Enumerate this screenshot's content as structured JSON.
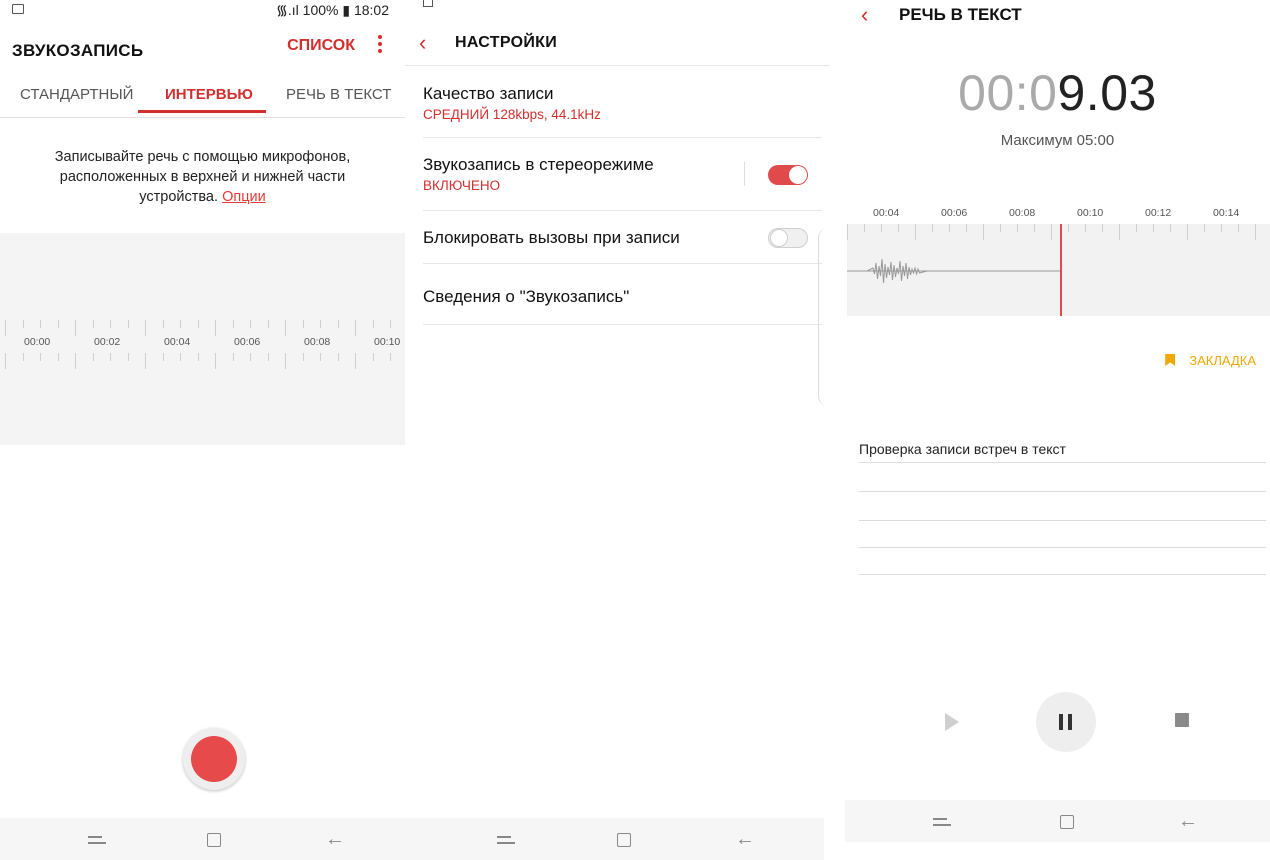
{
  "panel1": {
    "status": {
      "right": "᯾.ıl 100% ▮ 18:02"
    },
    "title": "ЗВУКОЗАПИСЬ",
    "list_label": "СПИСОК",
    "tabs": [
      "СТАНДАРТНЫЙ",
      "ИНТЕРВЬЮ",
      "РЕЧЬ В ТЕКСТ"
    ],
    "active_tab": "ИНТЕРВЬЮ",
    "description": "Записывайте речь с помощью микрофонов, расположенных в верхней и нижней части устройства.",
    "options_link": "Опции",
    "timeline": [
      "00:00",
      "00:02",
      "00:04",
      "00:06",
      "00:08",
      "00:10"
    ],
    "icons": {
      "more": "more-vert-icon",
      "record": "record-icon"
    }
  },
  "panel2": {
    "title": "НАСТРОЙКИ",
    "settings": [
      {
        "title": "Качество записи",
        "subtitle": "СРЕДНИЙ 128kbps, 44.1kHz"
      },
      {
        "title": "Звукозапись в стереорежиме",
        "subtitle": "ВКЛЮЧЕНО",
        "toggle": "on"
      },
      {
        "title": "Блокировать вызовы при записи",
        "toggle": "off"
      },
      {
        "title": "Сведения о \"Звукозапись\""
      }
    ]
  },
  "panel3": {
    "title": "РЕЧЬ В ТЕКСТ",
    "timer_dim": "00:0",
    "timer_bold": "9.03",
    "max_label": "Максимум 05:00",
    "timeline": [
      "00:04",
      "00:06",
      "00:08",
      "00:10",
      "00:12",
      "00:14"
    ],
    "bookmark_label": "ЗАКЛАДКА",
    "note_text": "Проверка записи встреч в текст",
    "icons": {
      "play": "play-icon",
      "pause": "pause-icon",
      "stop": "stop-icon"
    }
  },
  "colors": {
    "accent": "#d32f2f",
    "bookmark": "#f0a800",
    "toggle_on": "#e04a4a"
  }
}
